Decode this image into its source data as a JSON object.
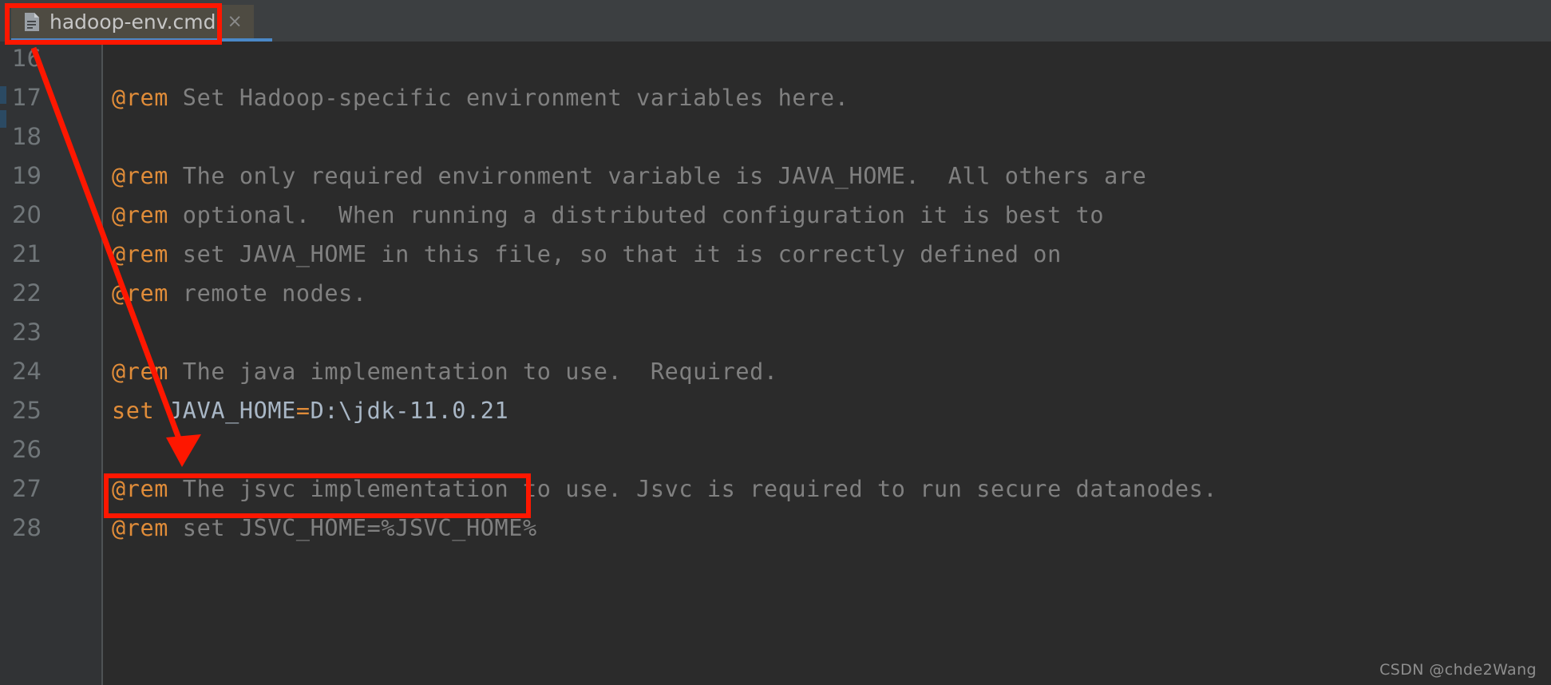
{
  "window": {
    "background_color": "#3c3f41",
    "editor_background_color": "#2b2b2b",
    "gutter_background_color": "#313335",
    "accent_color": "#4a88c7",
    "annotation_color": "#fe1700"
  },
  "toolbar": {
    "widget_label": ""
  },
  "tab": {
    "label": "hadoop-env.cmd",
    "close_label": "×",
    "icon": "cmd-file-icon",
    "active": true
  },
  "gutter": {
    "line_numbers": [
      "16",
      "17",
      "18",
      "19",
      "20",
      "21",
      "22",
      "23",
      "24",
      "25",
      "26",
      "27",
      "28"
    ]
  },
  "editor": {
    "lines": [
      {
        "n": "16",
        "tokens": []
      },
      {
        "n": "17",
        "tokens": [
          {
            "t": "@rem",
            "c": "tok-rem"
          },
          {
            "t": " Set Hadoop-specific environment variables here.",
            "c": "tok-cmt"
          }
        ]
      },
      {
        "n": "18",
        "tokens": []
      },
      {
        "n": "19",
        "tokens": [
          {
            "t": "@rem",
            "c": "tok-rem"
          },
          {
            "t": " The only required environment variable is JAVA_HOME.  All others are",
            "c": "tok-cmt"
          }
        ]
      },
      {
        "n": "20",
        "tokens": [
          {
            "t": "@rem",
            "c": "tok-rem"
          },
          {
            "t": " optional.  When running a distributed configuration it is best to",
            "c": "tok-cmt"
          }
        ]
      },
      {
        "n": "21",
        "tokens": [
          {
            "t": "@rem",
            "c": "tok-rem"
          },
          {
            "t": " set JAVA_HOME in this file, so that it is correctly defined on",
            "c": "tok-cmt"
          }
        ]
      },
      {
        "n": "22",
        "tokens": [
          {
            "t": "@rem",
            "c": "tok-rem"
          },
          {
            "t": " remote nodes.",
            "c": "tok-cmt"
          }
        ]
      },
      {
        "n": "23",
        "tokens": []
      },
      {
        "n": "24",
        "tokens": [
          {
            "t": "@rem",
            "c": "tok-rem"
          },
          {
            "t": " The java implementation to use.  Required.",
            "c": "tok-cmt"
          }
        ]
      },
      {
        "n": "25",
        "tokens": [
          {
            "t": "set",
            "c": "tok-kw"
          },
          {
            "t": " ",
            "c": "tok-var"
          },
          {
            "t": "JAVA_HOME",
            "c": "tok-var"
          },
          {
            "t": "=",
            "c": "tok-op"
          },
          {
            "t": "D:\\jdk-11.0.21",
            "c": "tok-val"
          }
        ]
      },
      {
        "n": "26",
        "tokens": []
      },
      {
        "n": "27",
        "tokens": [
          {
            "t": "@rem",
            "c": "tok-rem"
          },
          {
            "t": " The jsvc implementation to use. Jsvc is required to run secure datanodes.",
            "c": "tok-cmt"
          }
        ]
      },
      {
        "n": "28",
        "tokens": [
          {
            "t": "@rem",
            "c": "tok-rem"
          },
          {
            "t": " set JSVC_HOME=%JSVC_HOME%",
            "c": "tok-cmt"
          }
        ]
      }
    ]
  },
  "annotations": {
    "tab_highlight": {
      "label": "hadoop-env.cmd"
    },
    "line_highlight": {
      "label": "set JAVA_HOME=D:\\jdk-11.0.21"
    },
    "arrow": {
      "from": "tab-highlight",
      "to": "line-highlight"
    }
  },
  "watermark": {
    "text": "CSDN @chde2Wang"
  }
}
